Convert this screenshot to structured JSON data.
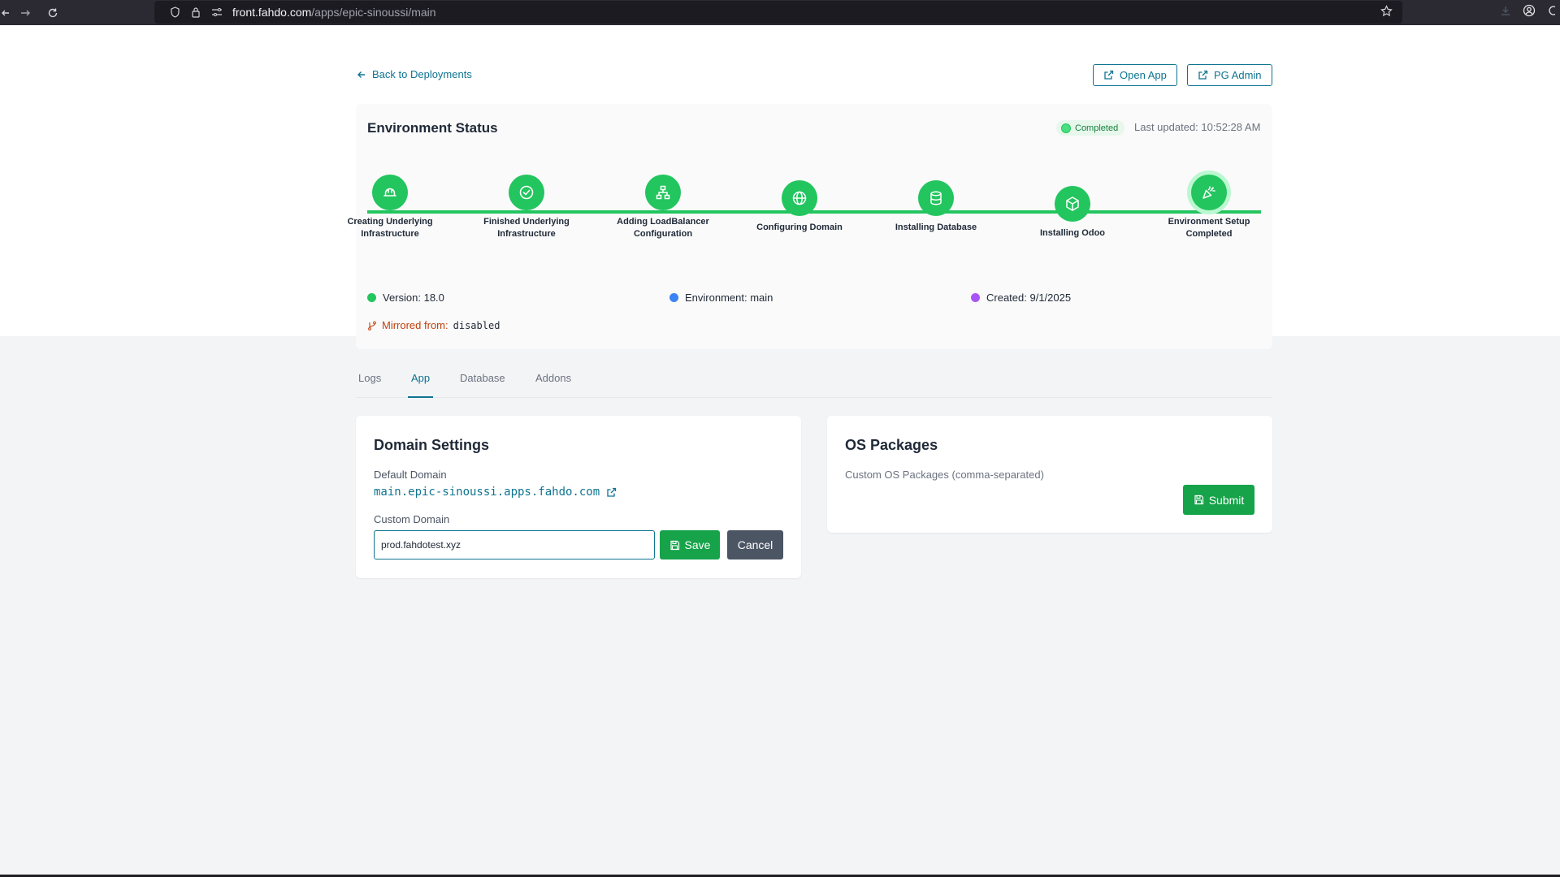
{
  "browser": {
    "url_domain": "front.fahdo.com",
    "url_path": "/apps/epic-sinoussi/main"
  },
  "header": {
    "back_label": "Back to Deployments",
    "open_app_label": "Open App",
    "pg_admin_label": "PG Admin"
  },
  "status": {
    "title": "Environment Status",
    "badge": "Completed",
    "last_updated": "Last updated: 10:52:28 AM",
    "steps": [
      {
        "label": "Creating Underlying Infrastructure",
        "icon": "hard-hat-icon"
      },
      {
        "label": "Finished Underlying Infrastructure",
        "icon": "check-circle-icon"
      },
      {
        "label": "Adding LoadBalancer Configuration",
        "icon": "network-icon"
      },
      {
        "label": "Configuring Domain",
        "icon": "globe-icon"
      },
      {
        "label": "Installing Database",
        "icon": "database-icon"
      },
      {
        "label": "Installing Odoo",
        "icon": "package-icon"
      },
      {
        "label": "Environment Setup Completed",
        "icon": "party-popper-icon"
      }
    ],
    "version": "Version: 18.0",
    "environment": "Environment: main",
    "created": "Created: 9/1/2025",
    "mirrored_label": "Mirrored from:",
    "mirrored_value": "disabled"
  },
  "tabs": [
    {
      "label": "Logs",
      "active": false
    },
    {
      "label": "App",
      "active": true
    },
    {
      "label": "Database",
      "active": false
    },
    {
      "label": "Addons",
      "active": false
    }
  ],
  "domain_settings": {
    "title": "Domain Settings",
    "default_label": "Default Domain",
    "default_value": "main.epic-sinoussi.apps.fahdo.com",
    "custom_label": "Custom Domain",
    "custom_value": "prod.fahdotest.xyz",
    "save_label": "Save",
    "cancel_label": "Cancel"
  },
  "os_packages": {
    "title": "OS Packages",
    "field_label": "Custom OS Packages (comma-separated)",
    "submit_label": "Submit"
  },
  "colors": {
    "accent": "#0e7490",
    "success": "#22c55e",
    "env_dot": "#3b82f6",
    "created_dot": "#a855f7",
    "mirrored": "#c2410c"
  }
}
